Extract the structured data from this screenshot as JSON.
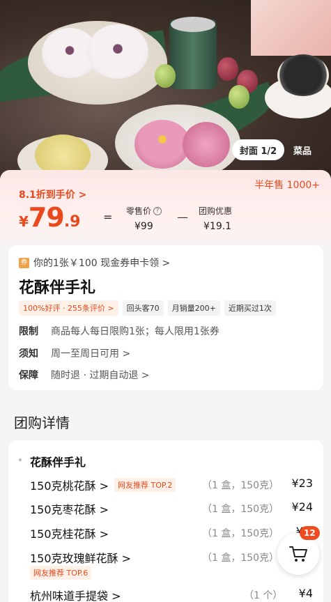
{
  "hero": {
    "cover_badge": "封面 1/2",
    "dish_tab": "菜品"
  },
  "price": {
    "discount_text": "8.1折到手价 >",
    "sold_text": "半年售 1000+",
    "currency": "¥",
    "integer": "79",
    "decimal": ".9",
    "equals": "=",
    "minus": "—",
    "retail_label": "零售价",
    "retail_value": "¥99",
    "group_label": "团购优惠",
    "group_value": "¥19.1"
  },
  "info": {
    "coupon_icon": "coupon-icon",
    "coupon_text": "你的1张￥100 现金券申卡领 >",
    "title": "花酥伴手礼",
    "tags": [
      "100%好评 · 255条评价 >",
      "回头客70",
      "月销量200+",
      "近期买过1次"
    ],
    "limit_label": "限制",
    "limit_value": "商品每人每日限购1张；每人限用1张券",
    "notice_label": "须知",
    "notice_value": "周一至周日可用 >",
    "guarantee_label": "保障",
    "guarantee_value": "随时退 · 过期自动退 >"
  },
  "detail": {
    "section_title": "团购详情",
    "package_name": "花酥伴手礼",
    "items": [
      {
        "name": "150克桃花酥 >",
        "rec": "网友推荐 TOP.2",
        "qty": "（1 盒，150克）",
        "price": "¥23"
      },
      {
        "name": "150克枣花酥 >",
        "rec": "",
        "qty": "（1 盒，150克）",
        "price": "¥24"
      },
      {
        "name": "150克桂花酥 >",
        "rec": "",
        "qty": "（1 盒，150克）",
        "price": "¥2"
      },
      {
        "name": "150克玫瑰鲜花酥 >",
        "rec": "网友推荐 TOP.6",
        "qty": "（1 盒，150克）",
        "price": ""
      },
      {
        "name": "杭州味道手提袋 >",
        "rec": "",
        "qty": "（1 个）",
        "price": "¥4"
      }
    ]
  },
  "cart": {
    "icon": "cart-icon",
    "count": "12"
  }
}
